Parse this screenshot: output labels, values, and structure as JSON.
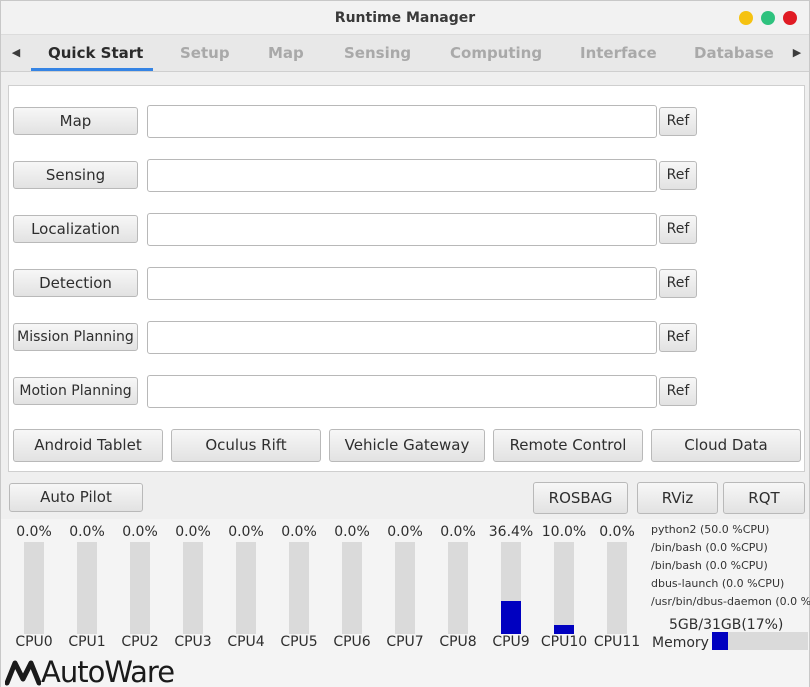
{
  "window": {
    "title": "Runtime Manager"
  },
  "tabs": [
    {
      "label": "Quick Start",
      "active": true
    },
    {
      "label": "Setup"
    },
    {
      "label": "Map"
    },
    {
      "label": "Sensing"
    },
    {
      "label": "Computing"
    },
    {
      "label": "Interface"
    },
    {
      "label": "Database"
    }
  ],
  "quickstart": {
    "rows": [
      {
        "label": "Map",
        "value": "",
        "ref": "Ref"
      },
      {
        "label": "Sensing",
        "value": "",
        "ref": "Ref"
      },
      {
        "label": "Localization",
        "value": "",
        "ref": "Ref"
      },
      {
        "label": "Detection",
        "value": "",
        "ref": "Ref"
      },
      {
        "label": "Mission Planning",
        "value": "",
        "ref": "Ref"
      },
      {
        "label": "Motion Planning",
        "value": "",
        "ref": "Ref"
      }
    ],
    "extra_buttons": [
      "Android Tablet",
      "Oculus Rift",
      "Vehicle Gateway",
      "Remote Control",
      "Cloud Data"
    ]
  },
  "bottom_buttons": {
    "auto_pilot": "Auto Pilot",
    "rosbag": "ROSBAG",
    "rviz": "RViz",
    "rqt": "RQT"
  },
  "cpus": [
    {
      "label": "CPU0",
      "pct": "0.0%",
      "load": 0.0
    },
    {
      "label": "CPU1",
      "pct": "0.0%",
      "load": 0.0
    },
    {
      "label": "CPU2",
      "pct": "0.0%",
      "load": 0.0
    },
    {
      "label": "CPU3",
      "pct": "0.0%",
      "load": 0.0
    },
    {
      "label": "CPU4",
      "pct": "0.0%",
      "load": 0.0
    },
    {
      "label": "CPU5",
      "pct": "0.0%",
      "load": 0.0
    },
    {
      "label": "CPU6",
      "pct": "0.0%",
      "load": 0.0
    },
    {
      "label": "CPU7",
      "pct": "0.0%",
      "load": 0.0
    },
    {
      "label": "CPU8",
      "pct": "0.0%",
      "load": 0.0
    },
    {
      "label": "CPU9",
      "pct": "36.4%",
      "load": 36.4
    },
    {
      "label": "CPU10",
      "pct": "10.0%",
      "load": 10.0
    },
    {
      "label": "CPU11",
      "pct": "0.0%",
      "load": 0.0
    }
  ],
  "processes": [
    "python2 (50.0 %CPU)",
    "/bin/bash (0.0 %CPU)",
    "/bin/bash (0.0 %CPU)",
    "dbus-launch (0.0 %CPU)",
    "/usr/bin/dbus-daemon (0.0 %"
  ],
  "memory": {
    "text": "5GB/31GB(17%)",
    "label": "Memory",
    "fraction": 0.17
  },
  "logo": {
    "text": "AutoWare"
  },
  "colors": {
    "accent": "#3584e4",
    "bar_fill": "#0000c0",
    "bar_bg": "#dadada"
  }
}
